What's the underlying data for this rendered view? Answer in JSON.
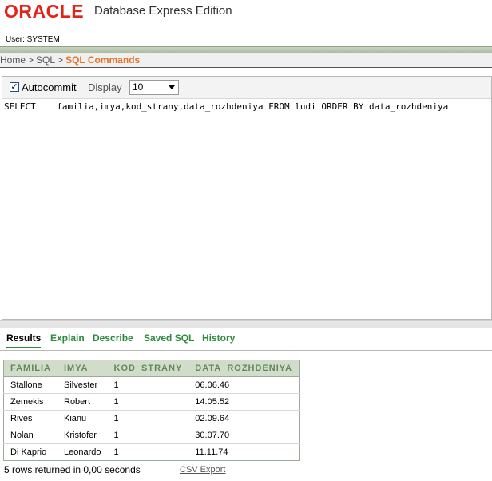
{
  "header": {
    "logo": "ORACLE",
    "product": "Database Express Edition",
    "user": "User: SYSTEM"
  },
  "breadcrumb": {
    "home": "Home",
    "sep1": ">",
    "sql": "SQL",
    "sep2": ">",
    "current": "SQL Commands"
  },
  "toolbar": {
    "autocommit_label": "Autocommit",
    "autocommit_checked": true,
    "display_label": "Display",
    "display_value": "10"
  },
  "editor": {
    "sql": "SELECT    familia,imya,kod_strany,data_rozhdeniya FROM ludi ORDER BY data_rozhdeniya"
  },
  "tabs": [
    {
      "label": "Results"
    },
    {
      "label": "Explain"
    },
    {
      "label": "Describe"
    },
    {
      "label": "Saved SQL"
    },
    {
      "label": "History"
    }
  ],
  "results": {
    "columns": [
      "FAMILIA",
      "IMYA",
      "KOD_STRANY",
      "DATA_ROZHDENIYA"
    ],
    "rows": [
      [
        "Stallone",
        "Silvester",
        "1",
        "06.06.46"
      ],
      [
        "Zemekis",
        "Robert",
        "1",
        "14.05.52"
      ],
      [
        "Rives",
        "Kianu",
        "1",
        "02.09.64"
      ],
      [
        "Nolan",
        "Kristofer",
        "1",
        "30.07.70"
      ],
      [
        "Di Kaprio",
        "Leonardo",
        "1",
        "11.11.74"
      ]
    ]
  },
  "footer": {
    "rows_returned": "5 rows returned in 0,00 seconds",
    "csv_export": "CSV Export"
  },
  "colors": {
    "oracle_red": "#e2231a",
    "current_crumb": "#e8732b",
    "tab_green": "#2c8a3e",
    "table_header_bg": "#d2dccb"
  }
}
